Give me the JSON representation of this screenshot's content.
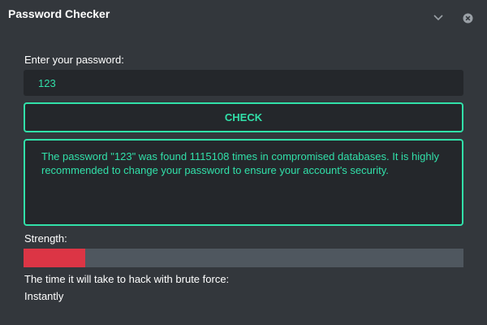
{
  "window": {
    "title": "Password Checker",
    "minimize_icon": "chevron-down-icon",
    "close_icon": "close-icon"
  },
  "form": {
    "input_label": "Enter your password:",
    "password_value": "123",
    "check_label": "CHECK"
  },
  "result": {
    "message": "The password \"123\" was found 1115108 times in compromised databases. It is highly recommended to change your password to ensure your account's security."
  },
  "strength": {
    "label": "Strength:",
    "level_fraction": 0.14,
    "fill_color": "#dc3545",
    "track_color": "#4f575f"
  },
  "brute_force": {
    "label": "The time it will take to hack with brute force:",
    "value": "Instantly"
  },
  "colors": {
    "accent": "#31e0a9",
    "background": "#33373c",
    "panel": "#24272b"
  }
}
